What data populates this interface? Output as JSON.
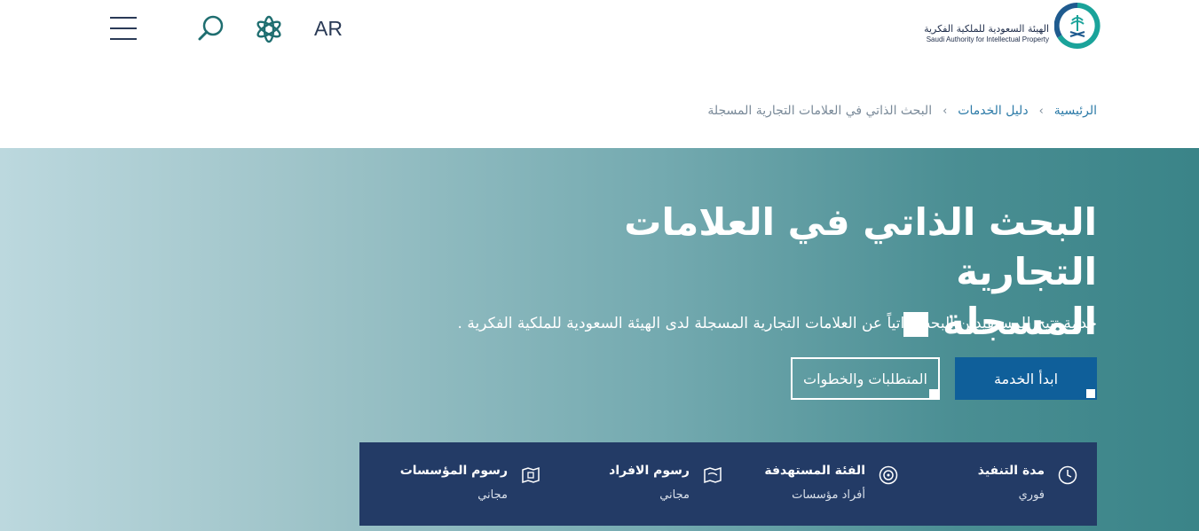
{
  "header": {
    "language_toggle": "AR",
    "logo": {
      "name_ar": "الهيئة السعودية للملكية الفكرية",
      "name_en": "Saudi Authority for Intellectual Property"
    }
  },
  "breadcrumb": {
    "home": "الرئيسية",
    "services": "دليل الخدمات",
    "current": "البحث الذاتي في العلامات التجارية المسجلة"
  },
  "hero": {
    "title_line1": "البحث الذاتي في العلامات التجارية",
    "title_line2": "المسجلة",
    "description": "خدمة تتيح للمستفيدين البحث ذاتياً عن العلامات التجارية المسجلة لدى الهيئة السعودية للملكية الفكرية .",
    "start_button": "ابدأ الخدمة",
    "requirements_button": "المتطلبات والخطوات"
  },
  "info": [
    {
      "label": "مدة التنفيذ",
      "value": "فوري",
      "icon": "clock-icon"
    },
    {
      "label": "الفئة المستهدفة",
      "value": "أفراد مؤسسات",
      "icon": "target-icon"
    },
    {
      "label": "رسوم الافراد",
      "value": "مجاني",
      "icon": "map-icon"
    },
    {
      "label": "رسوم المؤسسات",
      "value": "مجاني",
      "icon": "building-map-icon"
    }
  ],
  "colors": {
    "primary_blue": "#0f5f9a",
    "navy": "#233b66",
    "teal": "#3a8488",
    "link": "#2d7ba8"
  }
}
